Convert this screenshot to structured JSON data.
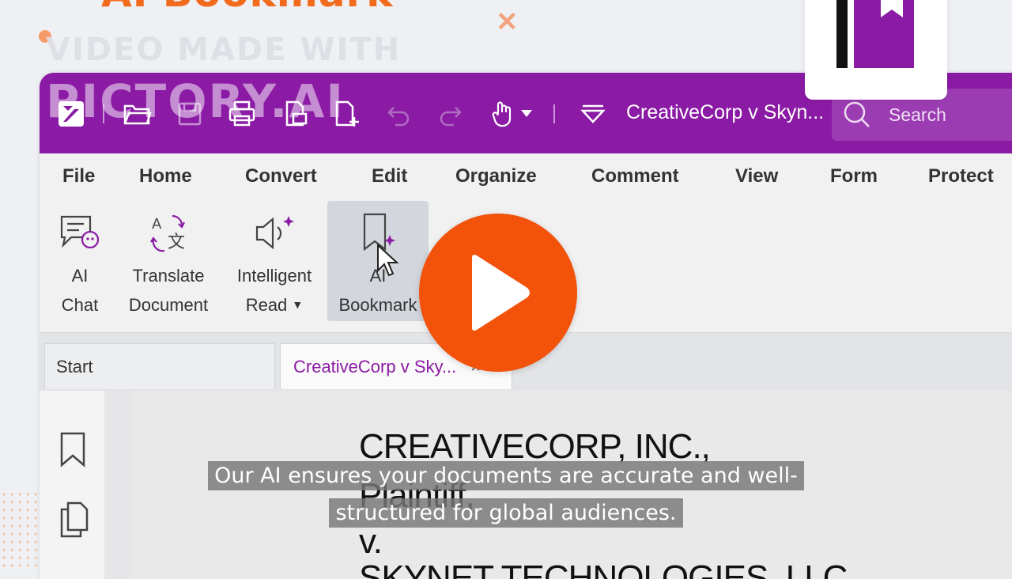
{
  "promo": {
    "title": "AI Bookmark",
    "watermark_line1": "VIDEO MADE WITH",
    "watermark_line2": "PICTORY.AI"
  },
  "titlebar": {
    "document_title": "CreativeCorp v Skyn...",
    "search_placeholder": "Search",
    "icons": [
      "app-logo-icon",
      "open-folder-icon",
      "save-icon",
      "print-icon",
      "scan-icon",
      "new-doc-icon",
      "undo-icon",
      "redo-icon",
      "hand-tool-icon",
      "dropdown-caret-icon",
      "quick-access-icon",
      "search-icon"
    ]
  },
  "menu": {
    "items": [
      "File",
      "Home",
      "Convert",
      "Edit",
      "Organize",
      "Comment",
      "View",
      "Form",
      "Protect"
    ]
  },
  "ribbon": {
    "buttons": [
      {
        "line1": "AI",
        "line2": "Chat",
        "icon": "ai-chat-icon"
      },
      {
        "line1": "Translate",
        "line2": "Document",
        "icon": "translate-icon"
      },
      {
        "line1": "Intelligent",
        "line2": "Read",
        "icon": "speaker-icon",
        "has_dropdown": true
      },
      {
        "line1": "AI",
        "line2": "Bookmark",
        "icon": "ai-bookmark-icon",
        "active": true
      }
    ]
  },
  "tabs": [
    {
      "label": "Start"
    },
    {
      "label": "CreativeCorp v Sky...",
      "close": "×",
      "active": true
    }
  ],
  "document": {
    "lines": [
      "CREATIVECORP, INC.,",
      "Plaintiff,",
      "v.",
      "SKYNET TECHNOLOGIES, LLC"
    ]
  },
  "subtitle": {
    "line1": "Our AI ensures your documents are accurate and well-",
    "line2": "structured for global audiences."
  },
  "colors": {
    "brand_purple": "#8b1aa4",
    "play_orange": "#f2520a",
    "promo_orange": "#f26b1d"
  }
}
